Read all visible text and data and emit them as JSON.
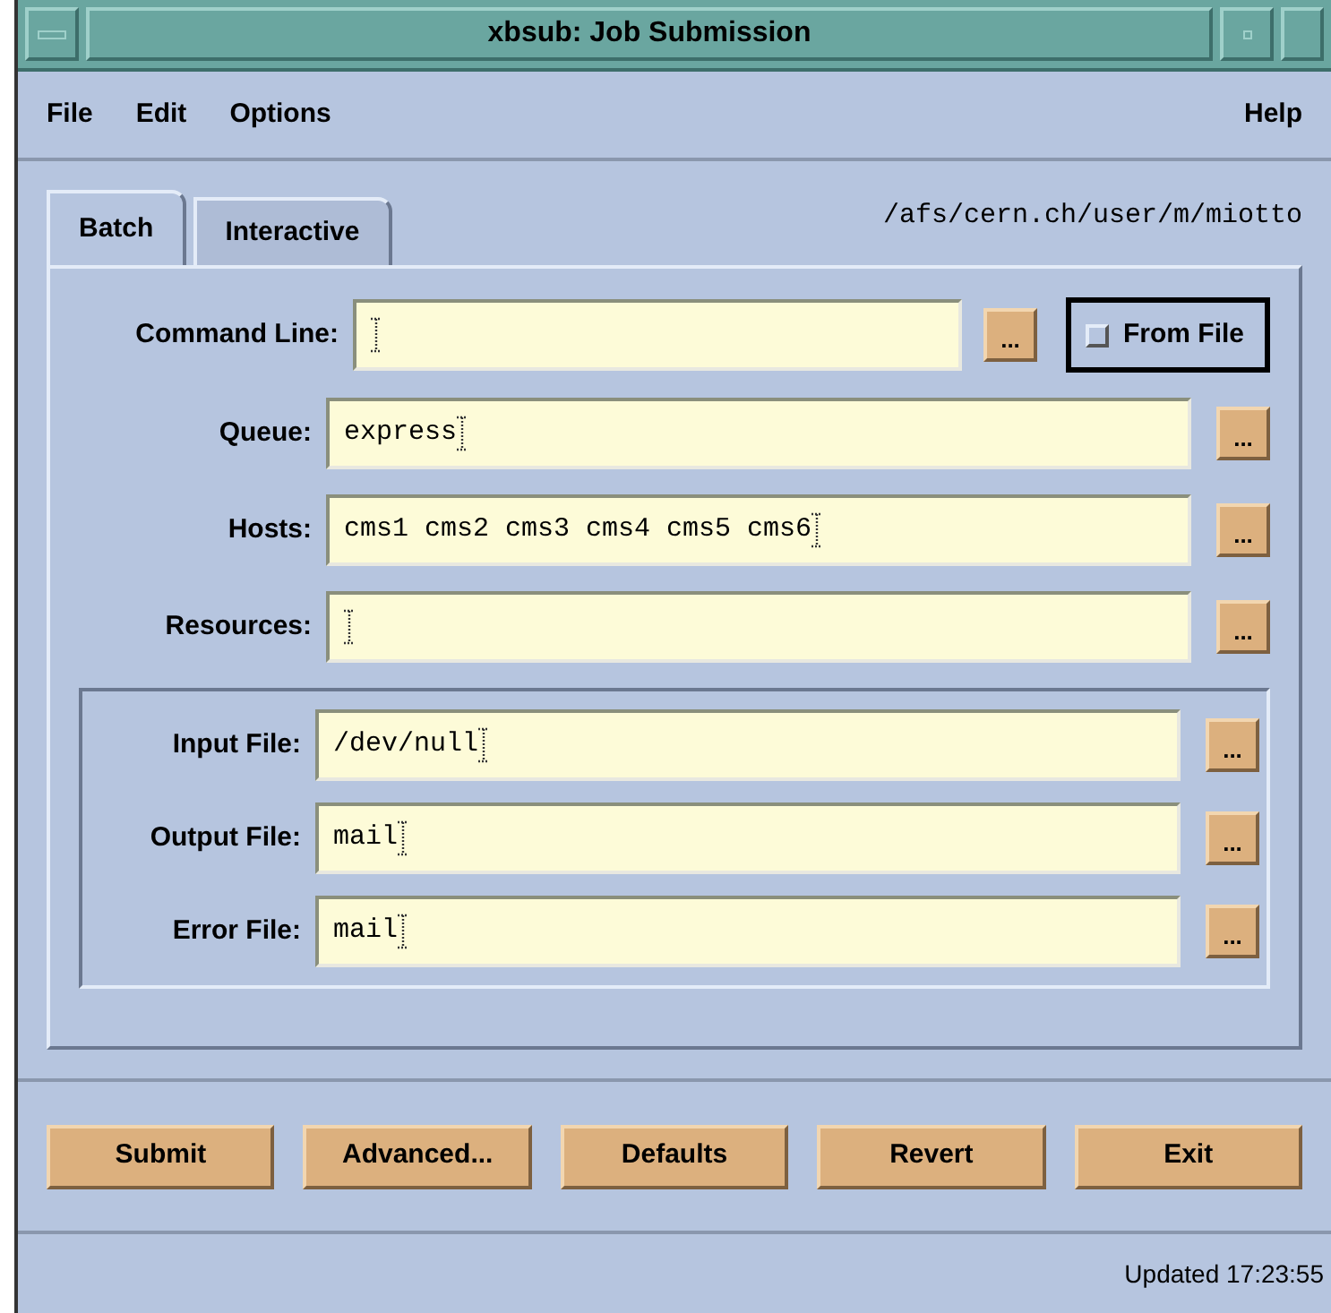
{
  "window": {
    "title": "xbsub: Job Submission"
  },
  "menu": {
    "items": [
      "File",
      "Edit",
      "Options"
    ],
    "help": "Help"
  },
  "tabs": [
    {
      "label": "Batch",
      "selected": true
    },
    {
      "label": "Interactive",
      "selected": false
    }
  ],
  "path": "/afs/cern.ch/user/m/miotto",
  "command_line": {
    "label": "Command Line:",
    "browse": "...",
    "from_file": {
      "label": "From File",
      "checked": false
    }
  },
  "fields": [
    {
      "label": "Queue:",
      "value": "express",
      "browse": "..."
    },
    {
      "label": "Hosts:",
      "value": "cms1 cms2 cms3 cms4 cms5 cms6",
      "browse": "..."
    },
    {
      "label": "Resources:",
      "browse": "..."
    }
  ],
  "files": [
    {
      "label": "Input File:",
      "value": "/dev/null",
      "browse": "..."
    },
    {
      "label": "Output File:",
      "value": "mail",
      "browse": "..."
    },
    {
      "label": "Error File:",
      "value": "mail",
      "browse": "..."
    }
  ],
  "buttons": [
    "Submit",
    "Advanced...",
    "Defaults",
    "Revert",
    "Exit"
  ],
  "status": "Updated 17:23:55"
}
